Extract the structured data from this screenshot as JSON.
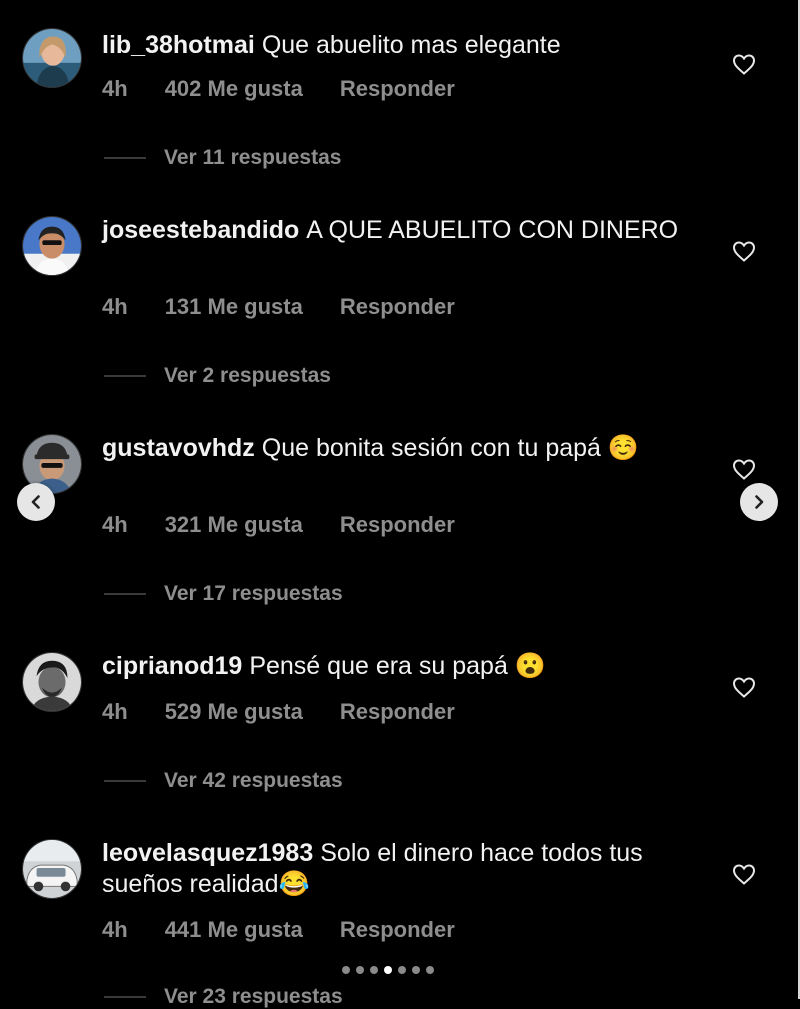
{
  "comments": [
    {
      "username": "lib_38hotmai",
      "text": "Que abuelito mas elegante",
      "time": "4h",
      "likes": "402 Me gusta",
      "reply": "Responder",
      "replies": "Ver 11 respuestas"
    },
    {
      "username": "joseestebandido",
      "text": "A QUE ABUELITO CON DINERO",
      "time": "4h",
      "likes": "131 Me gusta",
      "reply": "Responder",
      "replies": "Ver 2 respuestas"
    },
    {
      "username": "gustavovhdz",
      "text": "Que bonita sesión con tu papá ☺️",
      "time": "4h",
      "likes": "321 Me gusta",
      "reply": "Responder",
      "replies": "Ver 17 respuestas"
    },
    {
      "username": "ciprianod19",
      "text": "Pensé que era su papá 😮",
      "time": "4h",
      "likes": "529 Me gusta",
      "reply": "Responder",
      "replies": "Ver 42 respuestas"
    },
    {
      "username": "leovelasquez1983",
      "text": "Solo el dinero hace todos tus sueños realidad😂",
      "time": "4h",
      "likes": "441 Me gusta",
      "reply": "Responder",
      "replies": "Ver 23 respuestas"
    }
  ],
  "carousel": {
    "page_count": 7,
    "active_page": 4
  },
  "icons": {
    "like": "heart-icon",
    "prev": "chevron-left-icon",
    "next": "chevron-right-icon"
  }
}
